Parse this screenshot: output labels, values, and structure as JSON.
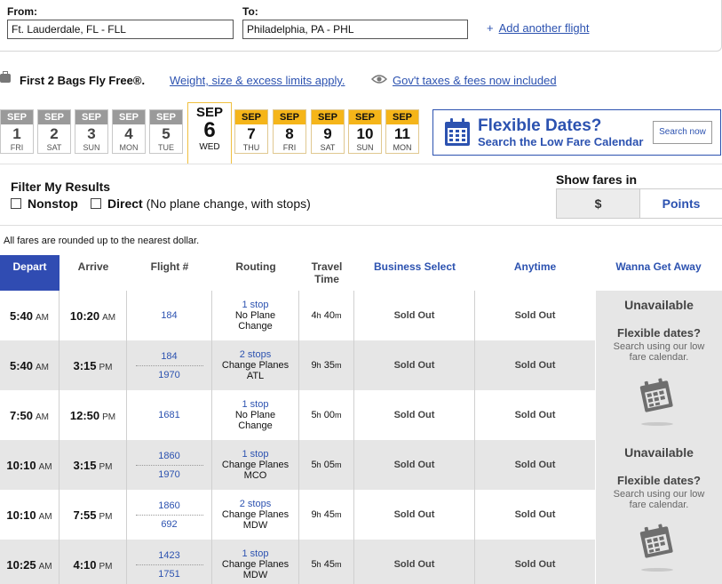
{
  "search": {
    "from_label": "From:",
    "from_value": "Ft. Lauderdale, FL - FLL",
    "to_label": "To:",
    "to_value": "Philadelphia, PA - PHL",
    "add_flight_plus": "+",
    "add_flight_label": "Add another flight"
  },
  "bags": {
    "title": "First 2 Bags Fly Free®.",
    "link": "Weight, size & excess limits apply.",
    "taxes_link": "Gov't taxes & fees now included"
  },
  "dates": [
    {
      "mon": "SEP",
      "day": "1",
      "dow": "FRI",
      "state": "past"
    },
    {
      "mon": "SEP",
      "day": "2",
      "dow": "SAT",
      "state": "past"
    },
    {
      "mon": "SEP",
      "day": "3",
      "dow": "SUN",
      "state": "past"
    },
    {
      "mon": "SEP",
      "day": "4",
      "dow": "MON",
      "state": "past"
    },
    {
      "mon": "SEP",
      "day": "5",
      "dow": "TUE",
      "state": "past"
    },
    {
      "mon": "SEP",
      "day": "6",
      "dow": "WED",
      "state": "selected"
    },
    {
      "mon": "SEP",
      "day": "7",
      "dow": "THU",
      "state": "future"
    },
    {
      "mon": "SEP",
      "day": "8",
      "dow": "FRI",
      "state": "future"
    },
    {
      "mon": "SEP",
      "day": "9",
      "dow": "SAT",
      "state": "future"
    },
    {
      "mon": "SEP",
      "day": "10",
      "dow": "SUN",
      "state": "future"
    },
    {
      "mon": "SEP",
      "day": "11",
      "dow": "MON",
      "state": "future"
    }
  ],
  "flexible": {
    "title": "Flexible Dates?",
    "subtitle": "Search the Low Fare Calendar",
    "button": "Search now"
  },
  "filter": {
    "title": "Filter My Results",
    "nonstop": "Nonstop",
    "direct": "Direct",
    "direct_note": "(No plane change, with stops)",
    "fares_in_label": "Show fares in",
    "dollar_option": "$",
    "points_option": "Points"
  },
  "rounding_note": "All fares are rounded up to the nearest dollar.",
  "table": {
    "headers": {
      "depart": "Depart",
      "arrive": "Arrive",
      "flight": "Flight #",
      "routing": "Routing",
      "travel_l1": "Travel",
      "travel_l2": "Time",
      "business": "Business Select",
      "anytime": "Anytime",
      "wanna": "Wanna Get Away"
    },
    "rows": [
      {
        "dep": "5:40",
        "dep_ampm": "AM",
        "arr": "10:20",
        "arr_ampm": "AM",
        "f1": "184",
        "f2": "",
        "stops": "1 stop",
        "route_l1": "No Plane",
        "route_l2": "Change",
        "tt_h": "4",
        "tt_m": "40",
        "business": "Sold Out",
        "anytime": "Sold Out"
      },
      {
        "dep": "5:40",
        "dep_ampm": "AM",
        "arr": "3:15",
        "arr_ampm": "PM",
        "f1": "184",
        "f2": "1970",
        "stops": "2 stops",
        "route_l1": "Change Planes",
        "route_l2": "ATL",
        "tt_h": "9",
        "tt_m": "35",
        "business": "Sold Out",
        "anytime": "Sold Out"
      },
      {
        "dep": "7:50",
        "dep_ampm": "AM",
        "arr": "12:50",
        "arr_ampm": "PM",
        "f1": "1681",
        "f2": "",
        "stops": "1 stop",
        "route_l1": "No Plane",
        "route_l2": "Change",
        "tt_h": "5",
        "tt_m": "00",
        "business": "Sold Out",
        "anytime": "Sold Out"
      },
      {
        "dep": "10:10",
        "dep_ampm": "AM",
        "arr": "3:15",
        "arr_ampm": "PM",
        "f1": "1860",
        "f2": "1970",
        "stops": "1 stop",
        "route_l1": "Change Planes",
        "route_l2": "MCO",
        "tt_h": "5",
        "tt_m": "05",
        "business": "Sold Out",
        "anytime": "Sold Out"
      },
      {
        "dep": "10:10",
        "dep_ampm": "AM",
        "arr": "7:55",
        "arr_ampm": "PM",
        "f1": "1860",
        "f2": "692",
        "stops": "2 stops",
        "route_l1": "Change Planes",
        "route_l2": "MDW",
        "tt_h": "9",
        "tt_m": "45",
        "business": "Sold Out",
        "anytime": "Sold Out"
      },
      {
        "dep": "10:25",
        "dep_ampm": "AM",
        "arr": "4:10",
        "arr_ampm": "PM",
        "f1": "1423",
        "f2": "1751",
        "stops": "1 stop",
        "route_l1": "Change Planes",
        "route_l2": "MDW",
        "tt_h": "5",
        "tt_m": "45",
        "business": "Sold Out",
        "anytime": "Sold Out"
      }
    ],
    "wanna": {
      "unavailable": "Unavailable",
      "flex_title": "Flexible dates?",
      "flex_sub_l1": "Search using our low",
      "flex_sub_l2": "fare calendar."
    }
  },
  "units": {
    "hours": "h",
    "minutes": "m"
  },
  "colors": {
    "brand_blue": "#304cb2",
    "link_blue": "#2c52b0",
    "future_date": "#f5b519",
    "past_date": "#9a9a9a"
  }
}
